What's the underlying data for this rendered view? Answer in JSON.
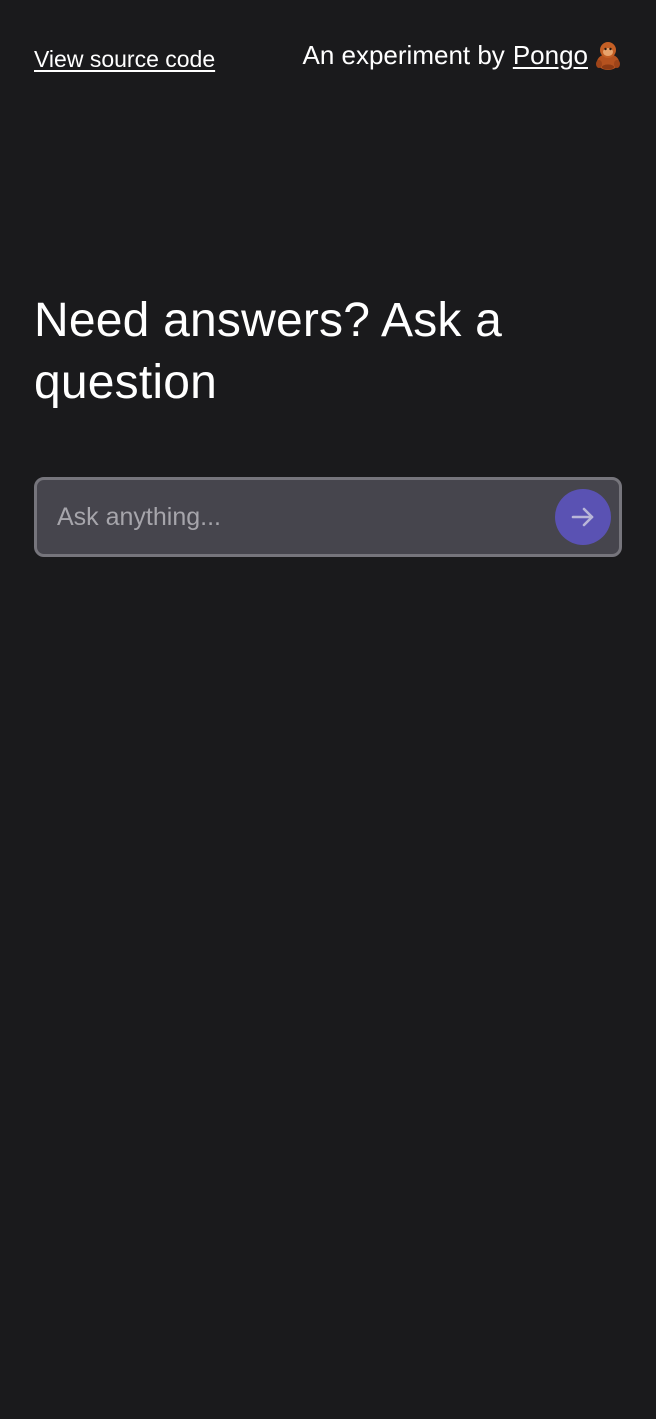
{
  "header": {
    "source_link_label": "View source code",
    "byline_prefix": "An experiment by",
    "author_link_label": "Pongo",
    "author_icon": "orangutan-icon"
  },
  "main": {
    "headline": "Need answers? Ask a question"
  },
  "search": {
    "placeholder": "Ask anything...",
    "value": "",
    "submit_icon": "arrow-right-icon"
  },
  "colors": {
    "background": "#1a1a1c",
    "input_background": "#46454d",
    "input_border": "#76757c",
    "accent": "#5a52b3",
    "text": "#ffffff",
    "placeholder": "#a6a5ab"
  }
}
